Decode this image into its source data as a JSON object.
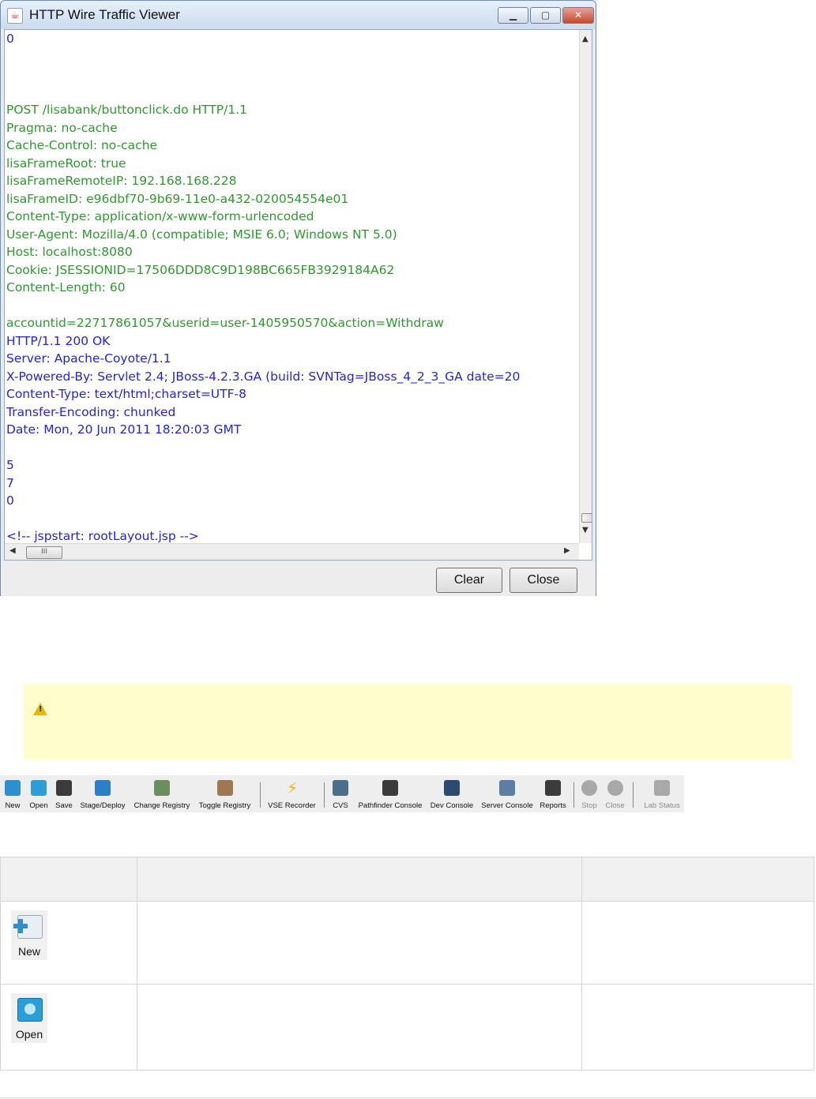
{
  "window": {
    "title": "HTTP Wire Traffic Viewer",
    "controls": {
      "minimize": "▁",
      "maximize": "▢",
      "close": "✕"
    },
    "lines": [
      {
        "text": "0",
        "color": "blue"
      },
      {
        "text": "",
        "color": "blue"
      },
      {
        "text": "",
        "color": "blue"
      },
      {
        "text": "",
        "color": "blue"
      },
      {
        "text": "POST /lisabank/buttonclick.do HTTP/1.1",
        "color": "green"
      },
      {
        "text": "Pragma: no-cache",
        "color": "green"
      },
      {
        "text": "Cache-Control: no-cache",
        "color": "green"
      },
      {
        "text": "lisaFrameRoot: true",
        "color": "green"
      },
      {
        "text": "lisaFrameRemoteIP: 192.168.168.228",
        "color": "green"
      },
      {
        "text": "lisaFrameID: e96dbf70-9b69-11e0-a432-020054554e01",
        "color": "green"
      },
      {
        "text": "Content-Type: application/x-www-form-urlencoded",
        "color": "green"
      },
      {
        "text": "User-Agent: Mozilla/4.0 (compatible; MSIE 6.0; Windows NT 5.0)",
        "color": "green"
      },
      {
        "text": "Host: localhost:8080",
        "color": "green"
      },
      {
        "text": "Cookie: JSESSIONID=17506DDD8C9D198BC665FB3929184A62",
        "color": "green"
      },
      {
        "text": "Content-Length: 60",
        "color": "green"
      },
      {
        "text": "",
        "color": "green"
      },
      {
        "text": "accountid=22717861057&userid=user-1405950570&action=Withdraw",
        "color": "green"
      },
      {
        "text": "HTTP/1.1 200 OK",
        "color": "blue"
      },
      {
        "text": "Server: Apache-Coyote/1.1",
        "color": "blue"
      },
      {
        "text": "X-Powered-By: Servlet 2.4; JBoss-4.2.3.GA (build: SVNTag=JBoss_4_2_3_GA date=20",
        "color": "blue"
      },
      {
        "text": "Content-Type: text/html;charset=UTF-8",
        "color": "blue"
      },
      {
        "text": "Transfer-Encoding: chunked",
        "color": "blue"
      },
      {
        "text": "Date: Mon, 20 Jun 2011 18:20:03 GMT",
        "color": "blue"
      },
      {
        "text": "",
        "color": "blue"
      },
      {
        "text": "5",
        "color": "blue"
      },
      {
        "text": "7",
        "color": "blue"
      },
      {
        "text": "0",
        "color": "blue"
      },
      {
        "text": "",
        "color": "blue"
      },
      {
        "text": "<!-- jspstart: rootLayout.jsp -->",
        "color": "blue"
      }
    ],
    "hscroll_thumb": "III",
    "buttons": {
      "clear": "Clear",
      "close": "Close"
    }
  },
  "toolbar": {
    "items": [
      {
        "label": "New",
        "icon": "new-icon",
        "color": "#2b8fd0"
      },
      {
        "label": "Open",
        "icon": "open-folder-icon",
        "color": "#2a9ed6"
      },
      {
        "label": "Save",
        "icon": "save-icon",
        "color": "#3b3b3b"
      },
      {
        "label": "Stage/Deploy",
        "icon": "gear-icon",
        "color": "#2a7fc9"
      },
      {
        "label": "Change Registry",
        "icon": "registry-icon",
        "color": "#6a8f5a"
      },
      {
        "label": "Toggle Registry",
        "icon": "toggle-registry-icon",
        "color": "#a07850"
      },
      {
        "label": "VSE Recorder",
        "icon": "lightning-icon",
        "color": "#f0b400"
      },
      {
        "label": "CVS",
        "icon": "cvs-icon",
        "color": "#4a6f8a"
      },
      {
        "label": "Pathfinder Console",
        "icon": "pathfinder-icon",
        "color": "#3b3b3b"
      },
      {
        "label": "Dev Console",
        "icon": "dev-console-icon",
        "color": "#2b4a6f"
      },
      {
        "label": "Server Console",
        "icon": "server-console-icon",
        "color": "#5a7fa0"
      },
      {
        "label": "Reports",
        "icon": "reports-icon",
        "color": "#3b3b3b"
      },
      {
        "label": "Stop",
        "icon": "stop-icon",
        "color": "#a8a8a8"
      },
      {
        "label": "Close",
        "icon": "close-circle-icon",
        "color": "#a8a8a8"
      },
      {
        "label": "Lab Status",
        "icon": "lab-status-icon",
        "color": "#a8a8a8"
      }
    ]
  },
  "table": {
    "rows": [
      {
        "label": "New",
        "icon": "new-icon",
        "color": "#2b8fd0"
      },
      {
        "label": "Open",
        "icon": "open-folder-icon",
        "color": "#2a9ed6"
      }
    ]
  }
}
